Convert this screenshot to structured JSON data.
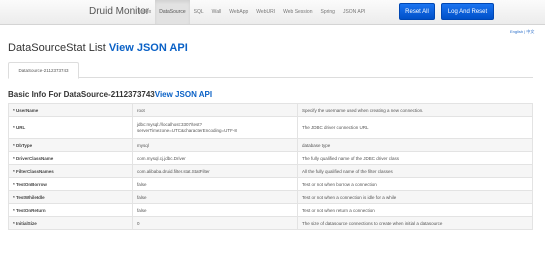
{
  "nav": {
    "brand": "Druid Monitor",
    "links": [
      "Index",
      "DataSource",
      "SQL",
      "Wall",
      "WebApp",
      "WebURI",
      "Web Session",
      "Spring",
      "JSON API"
    ],
    "active_index": 1,
    "reset_all": "Reset All",
    "log_and_reset": "Log And Reset"
  },
  "lang_switch": "English | 中文",
  "page": {
    "title": "DataSourceStat List",
    "title_link": "View JSON API"
  },
  "tabs": [
    "DataSource-2112373743"
  ],
  "section": {
    "title": "Basic Info For DataSource-2112373743",
    "link": "View JSON API"
  },
  "rows": [
    {
      "key": "* UserName",
      "value": "root",
      "desc": "Specify the username used when creating a new connection."
    },
    {
      "key": "* URL",
      "value": "jdbc:mysql://localhost:3307/test?serverTimezone=UTC&characterEncoding=UTF-8",
      "desc": "The JDBC driver connection URL"
    },
    {
      "key": "* DbType",
      "value": "mysql",
      "desc": "database type"
    },
    {
      "key": "* DriverClassName",
      "value": "com.mysql.cj.jdbc.Driver",
      "desc": "The fully qualified name of the JDBC driver class"
    },
    {
      "key": "* FilterClassNames",
      "value": "com.alibaba.druid.filter.stat.StatFilter",
      "desc": "All the fully qualified name of the filter classes"
    },
    {
      "key": "* TestOnBorrow",
      "value": "false",
      "desc": "Test or not when borrow a connection"
    },
    {
      "key": "* TestWhileIdle",
      "value": "false",
      "desc": "Test or not when a connection is idle for a while"
    },
    {
      "key": "* TestOnReturn",
      "value": "false",
      "desc": "Test or not when return a connection"
    },
    {
      "key": "* InitialSize",
      "value": "0",
      "desc": "The size of datasource connections to create when initial a datasource"
    }
  ]
}
